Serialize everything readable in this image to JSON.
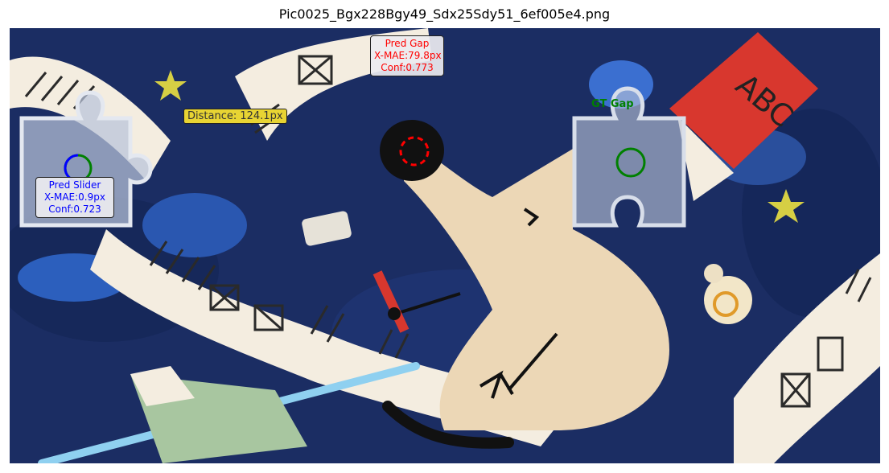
{
  "figure": {
    "title": "Pic0025_Bgx228Bgy49_Sdx25Sdy51_6ef005e4.png"
  },
  "annotations": {
    "pred_slider": {
      "title": "Pred Slider",
      "x_mae": "X-MAE:0.9px",
      "conf": "Conf:0.723",
      "color": "#0000ff"
    },
    "pred_gap": {
      "title": "Pred Gap",
      "x_mae": "X-MAE:79.8px",
      "conf": "Conf:0.773",
      "color": "#ff0000"
    },
    "gt_gap": {
      "title": "GT Gap",
      "color": "#008000"
    },
    "distance": {
      "text": "Distance: 124.1px",
      "color": "#e8d433"
    }
  },
  "scene": {
    "background_color": "#1b2d63",
    "drawing_text": "ABC"
  }
}
